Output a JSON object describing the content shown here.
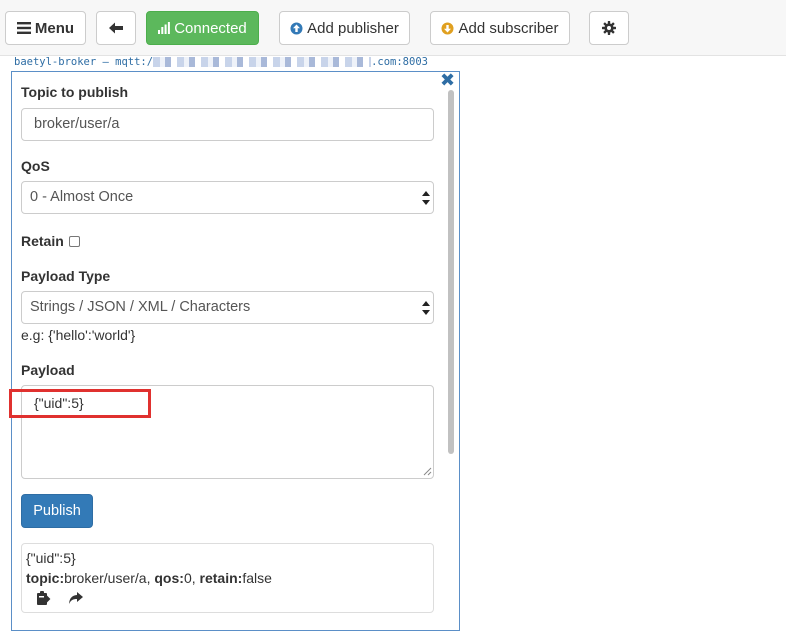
{
  "toolbar": {
    "menu_label": "Menu",
    "connected_label": "Connected",
    "add_publisher_label": "Add publisher",
    "add_subscriber_label": "Add subscriber"
  },
  "connection": {
    "prefix": "baetyl-broker – mqtt:/",
    "suffix": ".com:8003"
  },
  "publisher": {
    "topic_label": "Topic to publish",
    "topic_value": "broker/user/a",
    "qos_label": "QoS",
    "qos_value": "0 - Almost Once",
    "retain_label": "Retain",
    "payload_type_label": "Payload Type",
    "payload_type_value": "Strings / JSON / XML / Characters",
    "payload_hint": "e.g: {'hello':'world'}",
    "payload_label": "Payload",
    "payload_value": "{\"uid\":5}",
    "publish_label": "Publish"
  },
  "message": {
    "payload": "{\"uid\":5}",
    "topic_key": "topic:",
    "topic_value": "broker/user/a",
    "qos_key": "qos:",
    "qos_value": "0",
    "retain_key": "retain:",
    "retain_value": "false"
  },
  "icons": {
    "menu": "hamburger-icon",
    "back": "arrow-left-icon",
    "connected": "signal-bars-icon",
    "add_publisher": "circle-arrow-up-icon",
    "add_subscriber": "circle-arrow-down-icon",
    "settings": "gear-icon",
    "close": "close-icon",
    "copy": "clipboard-icon",
    "forward": "share-arrow-icon"
  },
  "colors": {
    "connected": "#5cb85c",
    "primary": "#337ab7",
    "link": "#2e6da4",
    "highlight": "#e0312f",
    "publisher_icon": "#337ab7",
    "subscriber_icon": "#e0a020"
  }
}
